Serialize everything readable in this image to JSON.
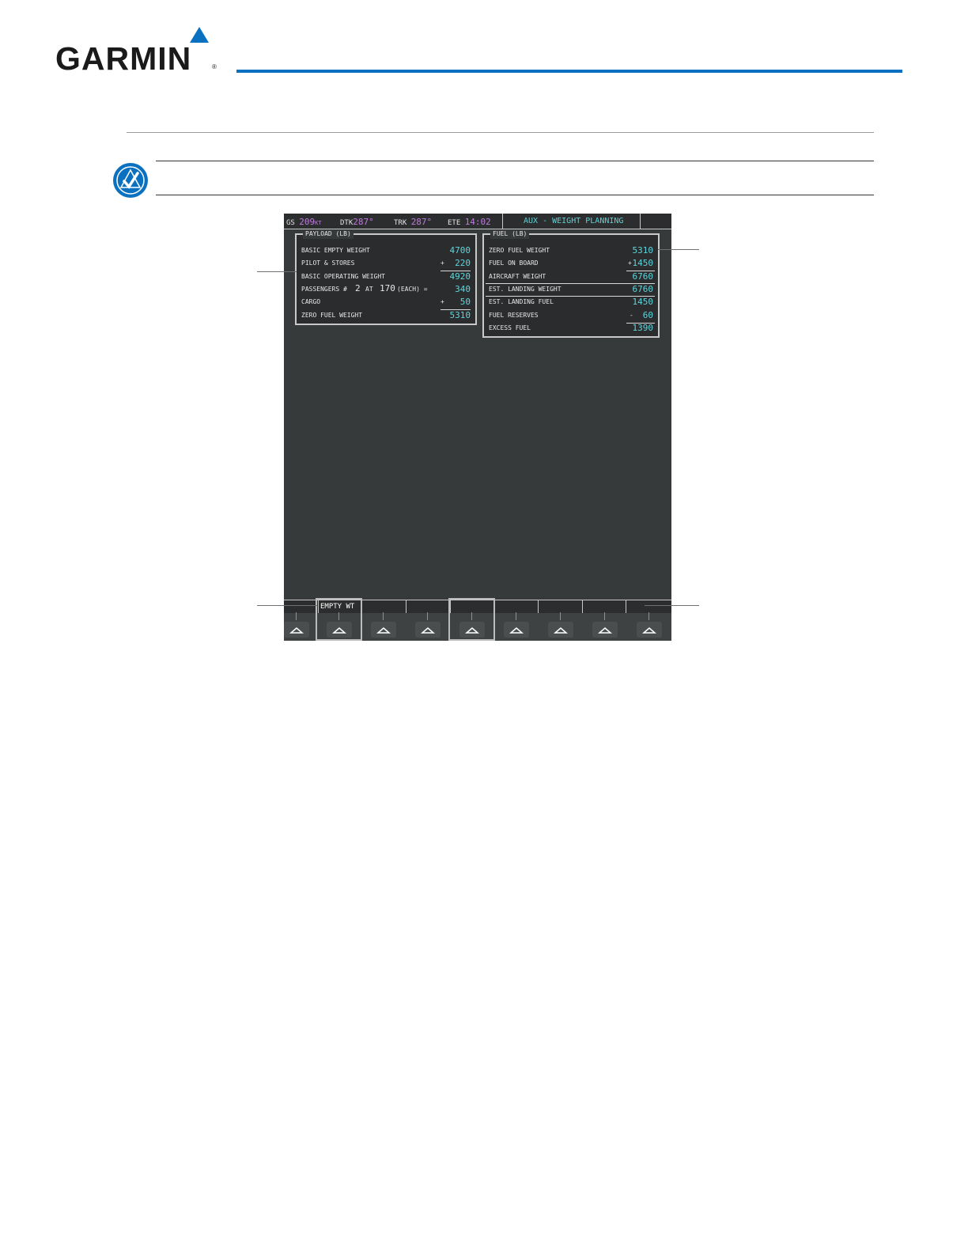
{
  "header": {
    "brand": "GARMIN",
    "registered_mark": "®",
    "rule_color": "#0a71c0"
  },
  "note": {
    "icon": "check-circle-icon",
    "icon_color": "#0a71c0"
  },
  "mfd": {
    "topbar": {
      "gs_label": "GS",
      "gs_value": "209",
      "gs_unit": "KT",
      "dtk_label": "DTK",
      "dtk_value": "287°",
      "trk_label": "TRK",
      "trk_value": "287°",
      "ete_label": "ETE",
      "ete_value": "14:02",
      "page_title": "AUX - WEIGHT PLANNING"
    },
    "payload": {
      "title": "PAYLOAD (LB)",
      "rows": [
        {
          "label": "BASIC EMPTY WEIGHT",
          "op": "",
          "value": "4700"
        },
        {
          "label": "PILOT & STORES",
          "op": "+",
          "value": "220"
        },
        {
          "label": "BASIC OPERATING WEIGHT",
          "op": "",
          "value": "4920"
        },
        {
          "label": "PASSENGERS #",
          "op": "",
          "value": "340"
        },
        {
          "label": "CARGO",
          "op": "+",
          "value": "50"
        },
        {
          "label": "ZERO FUEL WEIGHT",
          "op": "",
          "value": "5310"
        }
      ],
      "passengers": {
        "count": "2",
        "at": "AT",
        "each_weight": "170",
        "each_label": "(EACH) ="
      }
    },
    "fuel": {
      "title": "FUEL (LB)",
      "rows": [
        {
          "label": "ZERO FUEL WEIGHT",
          "op": "",
          "value": "5310"
        },
        {
          "label": "FUEL ON BOARD",
          "op": "+",
          "value": "1450"
        },
        {
          "label": "AIRCRAFT WEIGHT",
          "op": "",
          "value": "6760"
        },
        {
          "label": "EST. LANDING WEIGHT",
          "op": "",
          "value": "6760"
        },
        {
          "label": "EST. LANDING FUEL",
          "op": "",
          "value": "1450"
        },
        {
          "label": "FUEL RESERVES",
          "op": "-",
          "value": "60"
        },
        {
          "label": "EXCESS FUEL",
          "op": "",
          "value": "1390"
        }
      ]
    },
    "softkeys": [
      "",
      "EMPTY WT",
      "",
      "",
      "",
      "",
      "",
      "",
      ""
    ]
  }
}
